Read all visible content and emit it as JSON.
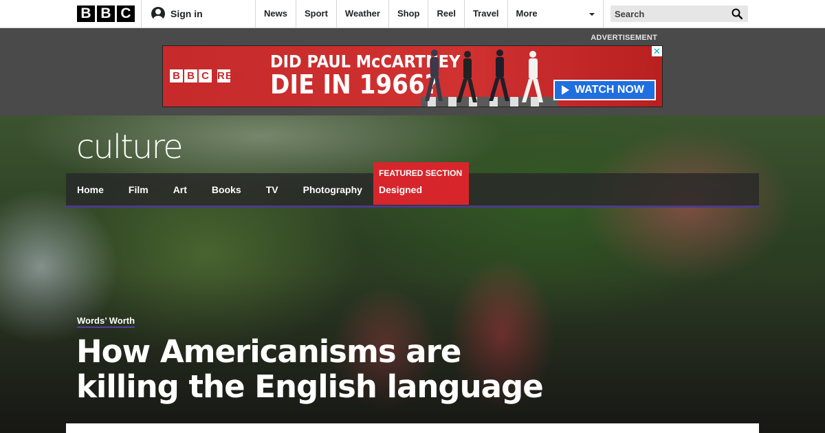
{
  "topbar": {
    "logo_letters": [
      "B",
      "B",
      "C"
    ],
    "signin_label": "Sign in",
    "nav": [
      "News",
      "Sport",
      "Weather",
      "Shop",
      "Reel",
      "Travel"
    ],
    "more_label": "More",
    "search_placeholder": "Search"
  },
  "ad": {
    "label": "ADVERTISEMENT",
    "brand_letters": [
      "B",
      "B",
      "C"
    ],
    "brand_product": "REEL",
    "headline_line1": "DID PAUL McCARTNEY",
    "headline_line2": "DIE IN 1966?",
    "cta_label": "WATCH NOW",
    "close_glyph": "✕"
  },
  "hero": {
    "section_logo": "culture",
    "nav": [
      "Home",
      "Film",
      "Art",
      "Books",
      "TV",
      "Photography"
    ],
    "featured_label": "FEATURED SECTION",
    "featured_title": "Designed",
    "kicker": "Words’ Worth",
    "headline": "How Americanisms are killing the English language"
  },
  "colors": {
    "ad_red": "#d03131",
    "cta_blue": "#1f6fe0",
    "featured_red": "#d6262c",
    "nav_underline": "#4b3a8c"
  }
}
